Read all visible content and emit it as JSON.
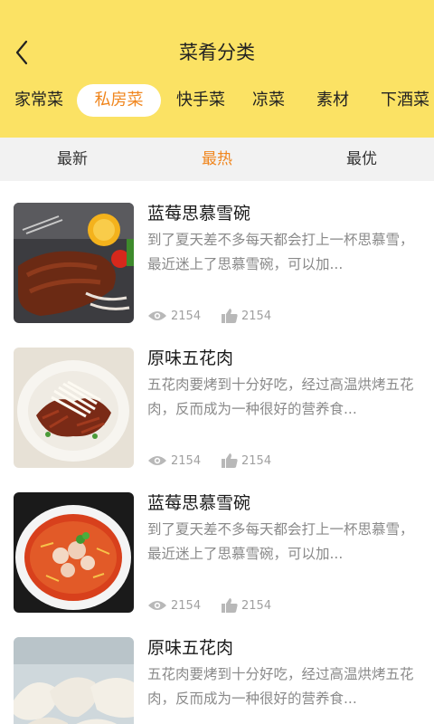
{
  "header": {
    "title": "菜肴分类",
    "categories": [
      "家常菜",
      "私房菜",
      "快手菜",
      "凉菜",
      "素材",
      "下酒菜"
    ],
    "active_category": "私房菜"
  },
  "sort": {
    "options": [
      "最新",
      "最热",
      "最优"
    ],
    "active": "最热"
  },
  "items": [
    {
      "title": "蓝莓思慕雪碗",
      "desc": "到了夏天差不多每天都会打上一杯思慕雪，最近迷上了思慕雪碗，可以加...",
      "views": "2154",
      "likes": "2154",
      "image": "ribs-icon"
    },
    {
      "title": "原味五花肉",
      "desc": "五花肉要烤到十分好吃，经过高温烘烤五花肉，反而成为一种很好的营养食...",
      "views": "2154",
      "likes": "2154",
      "image": "shredded-meat-icon"
    },
    {
      "title": "蓝莓思慕雪碗",
      "desc": "到了夏天差不多每天都会打上一杯思慕雪，最近迷上了思慕雪碗，可以加...",
      "views": "2154",
      "likes": "2154",
      "image": "soup-bowl-icon"
    },
    {
      "title": "原味五花肉",
      "desc": "五花肉要烤到十分好吃，经过高温烘烤五花肉，反而成为一种很好的营养食...",
      "views": "",
      "likes": "",
      "image": "dumplings-icon"
    }
  ],
  "colors": {
    "header_bg": "#fbe264",
    "accent": "#f0861e",
    "sort_bg": "#f2f2f2",
    "desc_text": "#8a8a8a"
  }
}
